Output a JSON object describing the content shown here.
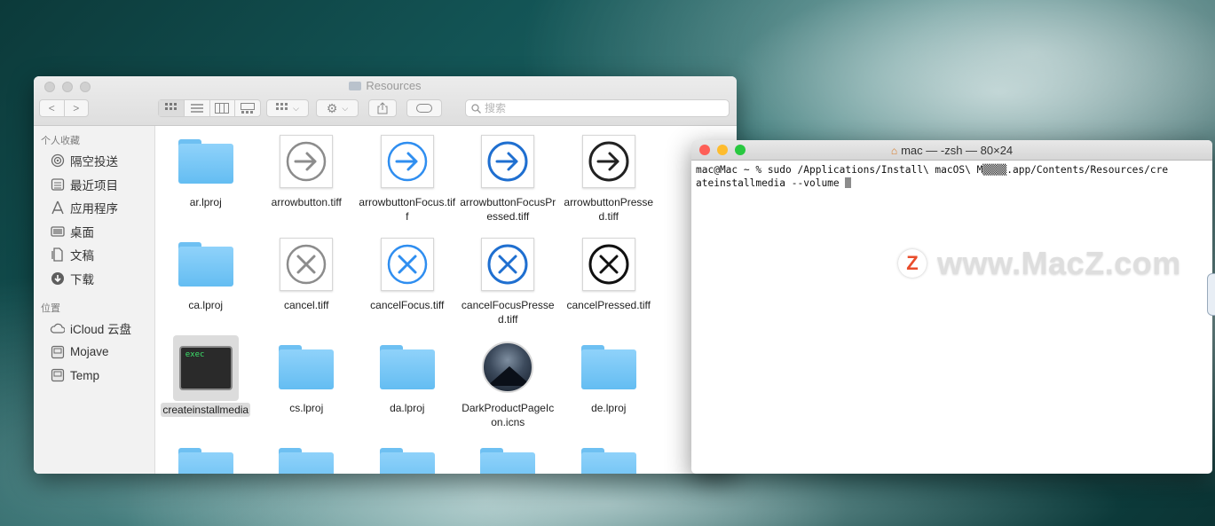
{
  "finder": {
    "title": "Resources",
    "toolbar": {
      "back": "<",
      "forward": ">",
      "search_placeholder": "搜索"
    },
    "sidebar": {
      "favorites_header": "个人收藏",
      "favorites": [
        {
          "label": "隔空投送",
          "icon": "airdrop-icon"
        },
        {
          "label": "最近项目",
          "icon": "recents-icon"
        },
        {
          "label": "应用程序",
          "icon": "applications-icon"
        },
        {
          "label": "桌面",
          "icon": "desktop-icon"
        },
        {
          "label": "文稿",
          "icon": "documents-icon"
        },
        {
          "label": "下载",
          "icon": "downloads-icon"
        }
      ],
      "locations_header": "位置",
      "locations": [
        {
          "label": "iCloud 云盘",
          "icon": "icloud-icon"
        },
        {
          "label": "Mojave",
          "icon": "disk-icon"
        },
        {
          "label": "Temp",
          "icon": "disk-icon"
        }
      ]
    },
    "files": [
      {
        "name": "ar.lproj",
        "kind": "folder"
      },
      {
        "name": "arrowbutton.tiff",
        "kind": "arrow-gray"
      },
      {
        "name": "arrowbuttonFocus.tiff",
        "kind": "arrow-focus"
      },
      {
        "name": "arrowbuttonFocusPressed.tiff",
        "kind": "arrow-focus-pressed"
      },
      {
        "name": "arrowbuttonPressed.tiff",
        "kind": "arrow-pressed"
      },
      {
        "name": "ca.lproj",
        "kind": "folder"
      },
      {
        "name": "cancel.tiff",
        "kind": "cancel-gray"
      },
      {
        "name": "cancelFocus.tiff",
        "kind": "cancel-focus"
      },
      {
        "name": "cancelFocusPressed.tiff",
        "kind": "cancel-focus-pressed"
      },
      {
        "name": "cancelPressed.tiff",
        "kind": "cancel-pressed"
      },
      {
        "name": "createinstallmedia",
        "kind": "exec",
        "selected": true
      },
      {
        "name": "cs.lproj",
        "kind": "folder"
      },
      {
        "name": "da.lproj",
        "kind": "folder"
      },
      {
        "name": "DarkProductPageIcon.icns",
        "kind": "icns"
      },
      {
        "name": "de.lproj",
        "kind": "folder"
      },
      {
        "name": "",
        "kind": "folder"
      },
      {
        "name": "",
        "kind": "folder"
      },
      {
        "name": "",
        "kind": "folder"
      },
      {
        "name": "",
        "kind": "folder"
      },
      {
        "name": "",
        "kind": "folder"
      }
    ],
    "exec_label": "exec"
  },
  "terminal": {
    "title": "mac — -zsh — 80×24",
    "line1": "mac@Mac ~ % sudo /Applications/Install\\ macOS\\ M▒▒▒▒.app/Contents/Resources/cre",
    "line2": "ateinstallmedia --volume "
  },
  "watermark": {
    "logo": "Z",
    "text": "www.MacZ.com"
  },
  "colors": {
    "folder_blue": "#6ec0f2",
    "focus_blue": "#2f8ef0",
    "pressed_blue": "#1f6fd0",
    "close_red": "#fe5f57",
    "minimize_yellow": "#febc2e",
    "zoom_green": "#28c840"
  }
}
